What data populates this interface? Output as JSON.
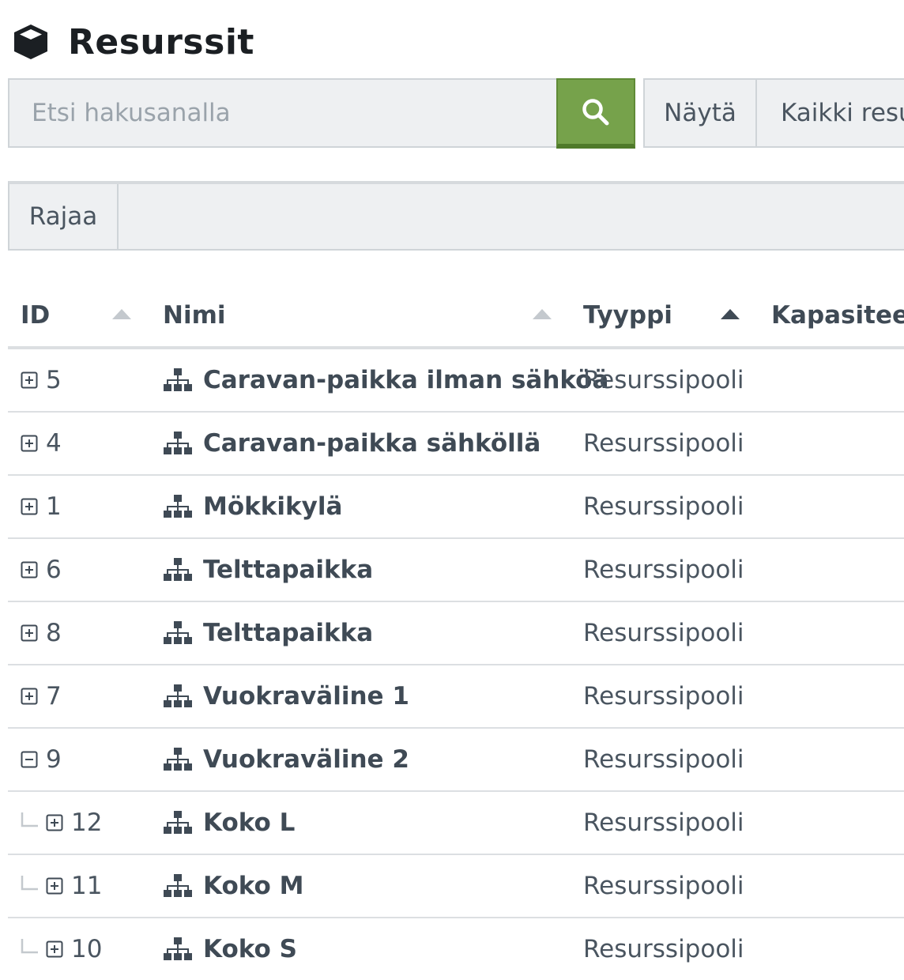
{
  "header": {
    "title": "Resurssit",
    "icon": "cube-icon"
  },
  "search": {
    "placeholder": "Etsi hakusanalla",
    "value": "",
    "button_icon": "search-icon",
    "button_color": "#76a24b"
  },
  "show": {
    "label": "Näytä",
    "selected": "Kaikki resu"
  },
  "filter": {
    "label": "Rajaa"
  },
  "table": {
    "columns": [
      {
        "key": "id",
        "label": "ID",
        "sort": "inactive"
      },
      {
        "key": "name",
        "label": "Nimi",
        "sort": "inactive"
      },
      {
        "key": "type",
        "label": "Tyyppi",
        "sort": "active"
      },
      {
        "key": "capacity",
        "label": "Kapasiteett",
        "sort": "none"
      }
    ],
    "rows": [
      {
        "id": "5",
        "name": "Caravan-paikka ilman sähköä",
        "type": "Resurssipooli",
        "expanded": false,
        "child": false
      },
      {
        "id": "4",
        "name": "Caravan-paikka sähköllä",
        "type": "Resurssipooli",
        "expanded": false,
        "child": false
      },
      {
        "id": "1",
        "name": "Mökkikylä",
        "type": "Resurssipooli",
        "expanded": false,
        "child": false
      },
      {
        "id": "6",
        "name": "Telttapaikka",
        "type": "Resurssipooli",
        "expanded": false,
        "child": false
      },
      {
        "id": "8",
        "name": "Telttapaikka",
        "type": "Resurssipooli",
        "expanded": false,
        "child": false
      },
      {
        "id": "7",
        "name": "Vuokraväline 1",
        "type": "Resurssipooli",
        "expanded": false,
        "child": false
      },
      {
        "id": "9",
        "name": "Vuokraväline 2",
        "type": "Resurssipooli",
        "expanded": true,
        "child": false
      },
      {
        "id": "12",
        "name": "Koko L",
        "type": "Resurssipooli",
        "expanded": false,
        "child": true
      },
      {
        "id": "11",
        "name": "Koko M",
        "type": "Resurssipooli",
        "expanded": false,
        "child": true
      },
      {
        "id": "10",
        "name": "Koko S",
        "type": "Resurssipooli",
        "expanded": false,
        "child": true
      }
    ]
  }
}
